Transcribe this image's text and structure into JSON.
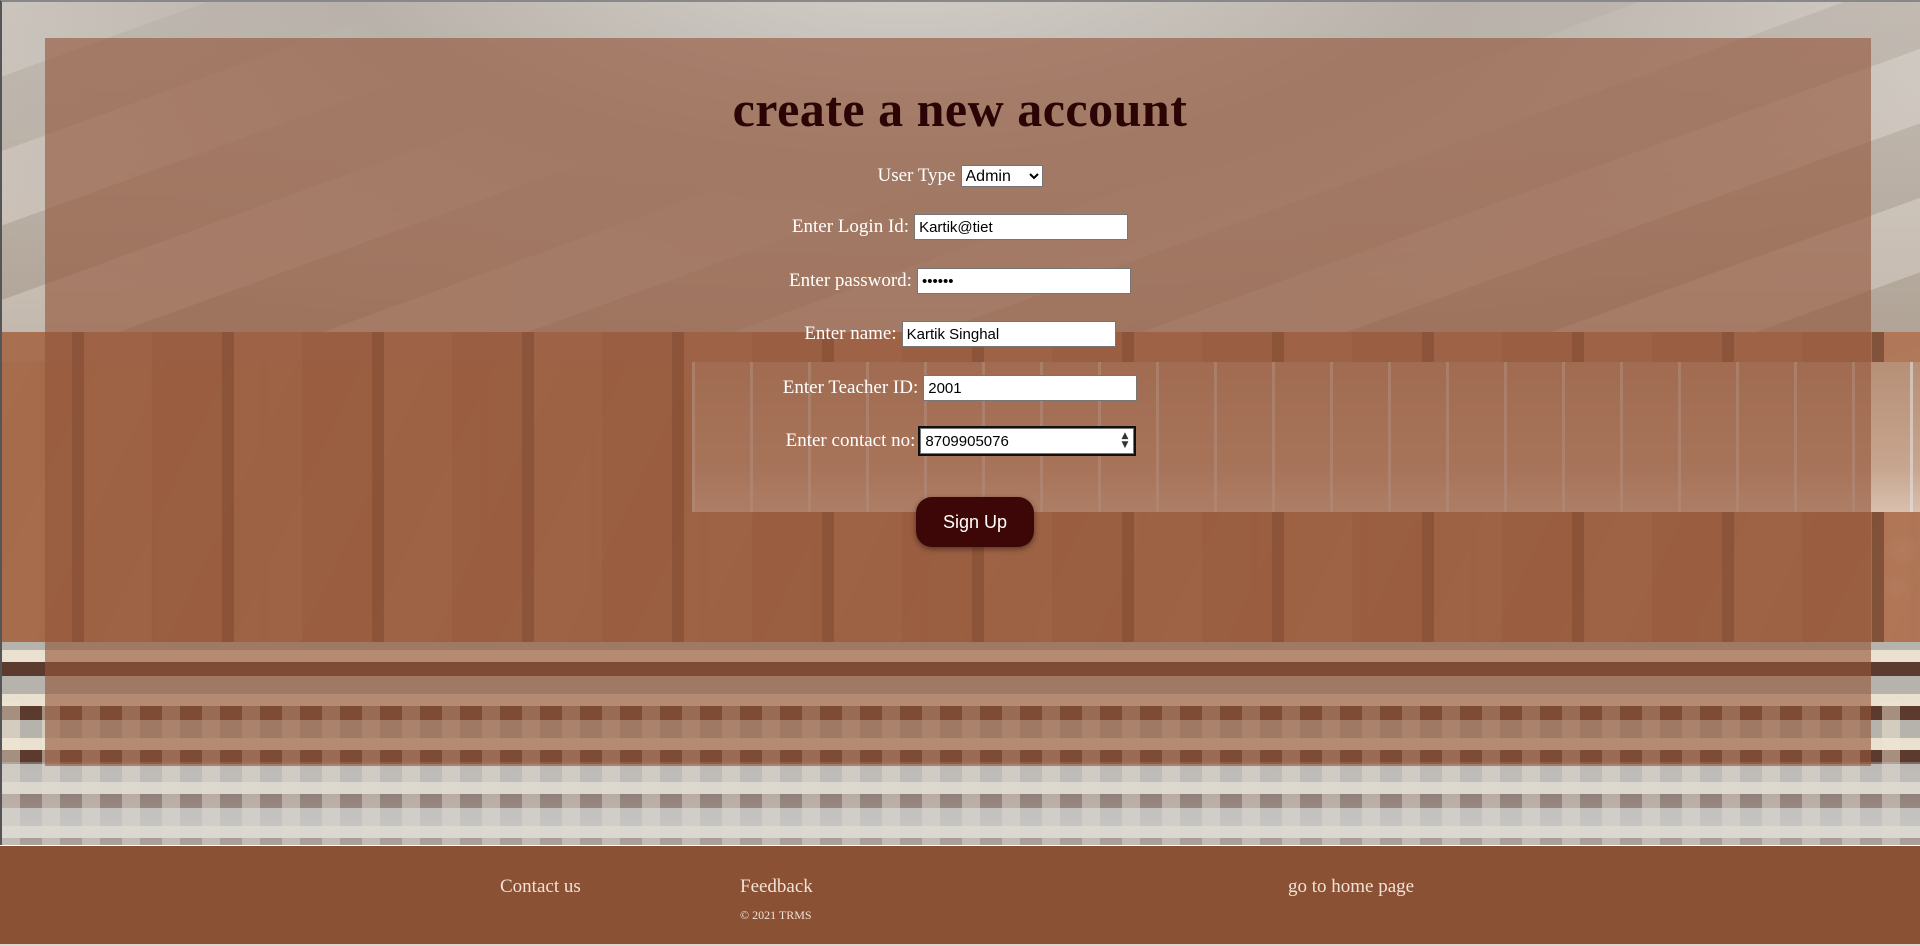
{
  "form": {
    "title": "create a new account",
    "user_type_label": "User Type",
    "user_type_value": "Admin",
    "login_label": "Enter Login Id:",
    "login_value": "Kartik@tiet",
    "password_label": "Enter password:",
    "password_value": "••••••",
    "name_label": "Enter name:",
    "name_value": "Kartik Singhal",
    "teacher_label": "Enter Teacher ID:",
    "teacher_value": "2001",
    "contact_label": "Enter contact no:",
    "contact_value": "8709905076",
    "submit_label": "Sign Up"
  },
  "footer": {
    "contact": "Contact us",
    "feedback": "Feedback",
    "home": "go to home page",
    "copyright": "© 2021 TRMS"
  },
  "colors": {
    "footer_bg": "#8a5134",
    "overlay": "#93563a",
    "button_bg": "#3d0707",
    "title": "#2b0505"
  }
}
